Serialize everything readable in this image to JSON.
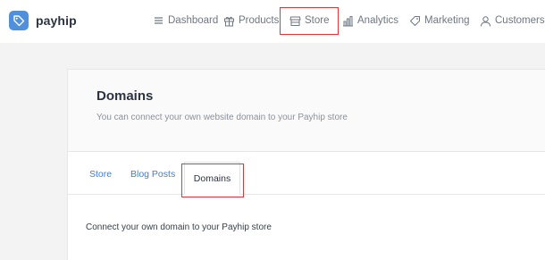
{
  "brand": {
    "name": "payhip",
    "logo_color": "#4f8fdc",
    "logo_icon": "tag-icon"
  },
  "nav": {
    "dashboard": {
      "label": "Dashboard",
      "icon": "menu-icon"
    },
    "products": {
      "label": "Products",
      "icon": "gift-icon"
    },
    "store": {
      "label": "Store",
      "icon": "storefront-icon"
    },
    "analytics": {
      "label": "Analytics",
      "icon": "bar-chart-icon"
    },
    "marketing": {
      "label": "Marketing",
      "icon": "tag-icon"
    },
    "customers": {
      "label": "Customers",
      "icon": "user-icon"
    }
  },
  "page": {
    "title": "Domains",
    "subtitle": "You can connect your own website domain to your Payhip store"
  },
  "tabs": [
    {
      "label": "Store",
      "active": false
    },
    {
      "label": "Blog Posts",
      "active": false
    },
    {
      "label": "Domains",
      "active": true
    }
  ],
  "content": {
    "intro": "Connect your own domain to your Payhip store"
  },
  "colors": {
    "link": "#3f80cf",
    "highlight": "#e0353b",
    "background": "#f3f3f4"
  }
}
